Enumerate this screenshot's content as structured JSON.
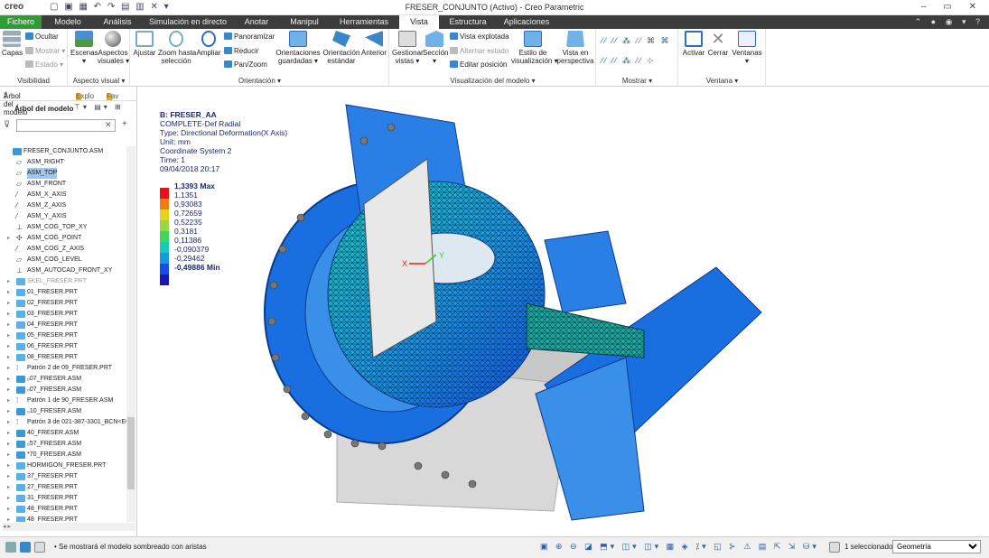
{
  "app": {
    "logo": "creo",
    "quick_access": "▢ ▣ ▦ ↶ ↷ ▤ ▥ ✕ ▾",
    "window_title": "FRESER_CONJUNTO (Activo) - Creo Parametric",
    "window_controls": "– ▭ ✕",
    "right_tools": "⌃ ● ◉ ▾ ?"
  },
  "tabs": [
    "Fichero",
    "Modelo",
    "Análisis",
    "Simulación en directo",
    "Anotar",
    "Manipul",
    "Herramientas",
    "Vista",
    "Estructura",
    "Aplicaciones"
  ],
  "ribbon": {
    "visibilidad": {
      "group": "Visibilidad",
      "capas": "Capas",
      "ocultar": "Ocultar",
      "mostrar": "Mostrar ▾",
      "estado": "Estado ▾"
    },
    "aspecto": {
      "group": "Aspecto visual ▾",
      "escenas": "Escenas\n▾",
      "aspectos": "Aspectos\nvisuales ▾"
    },
    "orientacion": {
      "group": "Orientación ▾",
      "ajustar": "Ajustar",
      "zoom_seleccion": "Zoom hasta\nselección",
      "ampliar": "Ampliar",
      "panoramizar": "Panoramizar",
      "reducir": "Reducir",
      "pan_zoom": "Pan/Zoom",
      "orientaciones": "Orientaciones\nguardadas ▾",
      "orientacion_estandar": "Orientación\nestándar",
      "anterior": "Anterior"
    },
    "visualizacion": {
      "group": "Visualización del modelo ▾",
      "gestionar": "Gestionar\nvistas ▾",
      "seccion": "Sección\n▾",
      "vista_explotada": "Vista explotada",
      "alternar_estado": "Alternar estado",
      "editar_posicion": "Editar posición",
      "estilo": "Estilo de\nvisualización ▾",
      "perspectiva": "Vista en\nperspectiva"
    },
    "mostrar": {
      "group": "Mostrar ▾"
    },
    "ventana": {
      "group": "Ventana ▾",
      "activar": "Activar",
      "cerrar": "Cerrar",
      "ventanas": "Ventanas\n▾"
    }
  },
  "panel": {
    "tab_tree": "Árbol del modelo",
    "tab_explorer": "Explo",
    "tab_fav": "Fav",
    "tree_header": "Árbol del modelo",
    "tree_tools": "⊤▾ ▤▾ ⊞",
    "search_placeholder": "",
    "scroll_arrows": "◂                                  ▸"
  },
  "tree": [
    {
      "t": "FRESER_CONJUNTO.ASM",
      "lvl": 0,
      "ic": "asm",
      "tw": ""
    },
    {
      "t": "ASM_RIGHT",
      "lvl": 1,
      "ic": "plane",
      "tw": ""
    },
    {
      "t": "ASM_TOP",
      "lvl": 1,
      "ic": "plane",
      "tw": "",
      "sel": true
    },
    {
      "t": "ASM_FRONT",
      "lvl": 1,
      "ic": "plane",
      "tw": ""
    },
    {
      "t": "ASM_X_AXIS",
      "lvl": 1,
      "ic": "axis",
      "tw": ""
    },
    {
      "t": "ASM_Z_AXIS",
      "lvl": 1,
      "ic": "axis",
      "tw": ""
    },
    {
      "t": "ASM_Y_AXIS",
      "lvl": 1,
      "ic": "axis",
      "tw": ""
    },
    {
      "t": "ASM_COG_TOP_XY",
      "lvl": 1,
      "ic": "csys",
      "tw": ""
    },
    {
      "t": "ASM_COG_POINT",
      "lvl": 1,
      "ic": "point",
      "tw": "▸"
    },
    {
      "t": "ASM_COG_Z_AXIS",
      "lvl": 1,
      "ic": "axis",
      "tw": ""
    },
    {
      "t": "ASM_COG_LEVEL",
      "lvl": 1,
      "ic": "plane",
      "tw": ""
    },
    {
      "t": "ASM_AUTOCAD_FRONT_XY",
      "lvl": 1,
      "ic": "csys",
      "tw": ""
    },
    {
      "t": "SKEL_FRESER.PRT",
      "lvl": 1,
      "ic": "part",
      "tw": "▸",
      "gray": true
    },
    {
      "t": "01_FRESER.PRT",
      "lvl": 1,
      "ic": "part",
      "tw": "▸"
    },
    {
      "t": "02_FRESER.PRT",
      "lvl": 1,
      "ic": "part",
      "tw": "▸"
    },
    {
      "t": "03_FRESER.PRT",
      "lvl": 1,
      "ic": "part",
      "tw": "▸"
    },
    {
      "t": "04_FRESER.PRT",
      "lvl": 1,
      "ic": "part",
      "tw": "▸"
    },
    {
      "t": "05_FRESER.PRT",
      "lvl": 1,
      "ic": "part",
      "tw": "▸"
    },
    {
      "t": "06_FRESER.PRT",
      "lvl": 1,
      "ic": "part",
      "tw": "▸"
    },
    {
      "t": "08_FRESER.PRT",
      "lvl": 1,
      "ic": "part",
      "tw": "▸"
    },
    {
      "t": "Patrón 2 de 09_FRESER.PRT",
      "lvl": 1,
      "ic": "pattern",
      "tw": "▸"
    },
    {
      "t": "₀07_FRESER.ASM",
      "lvl": 1,
      "ic": "asm",
      "tw": "▸"
    },
    {
      "t": "₀07_FRESER.ASM",
      "lvl": 1,
      "ic": "asm",
      "tw": "▸"
    },
    {
      "t": "Patrón 1 de 90_FRESER.ASM",
      "lvl": 1,
      "ic": "pattern",
      "tw": "▸"
    },
    {
      "t": "₀10_FRESER.ASM",
      "lvl": 1,
      "ic": "asm",
      "tw": "▸"
    },
    {
      "t": "Patrón 3 de 021-387-3301_BCN<EC",
      "lvl": 1,
      "ic": "pattern",
      "tw": "▸"
    },
    {
      "t": "40_FRESER.ASM",
      "lvl": 1,
      "ic": "asm",
      "tw": "▸"
    },
    {
      "t": "₀57_FRESER.ASM",
      "lvl": 1,
      "ic": "asm",
      "tw": "▸"
    },
    {
      "t": "*70_FRESER.ASM",
      "lvl": 1,
      "ic": "asm",
      "tw": "▸"
    },
    {
      "t": "HORMIGON_FRESER.PRT",
      "lvl": 1,
      "ic": "part",
      "tw": "▸"
    },
    {
      "t": "37_FRESER.PRT",
      "lvl": 1,
      "ic": "part",
      "tw": "▸"
    },
    {
      "t": "27_FRESER.PRT",
      "lvl": 1,
      "ic": "part",
      "tw": "▸"
    },
    {
      "t": "31_FRESER.PRT",
      "lvl": 1,
      "ic": "part",
      "tw": "▸"
    },
    {
      "t": "48_FRESER.PRT",
      "lvl": 1,
      "ic": "part",
      "tw": "▸"
    },
    {
      "t": "48_FRESER.PRT",
      "lvl": 1,
      "ic": "part",
      "tw": "▸"
    }
  ],
  "result": {
    "title": "B: FRESER_AA",
    "subtitle": "COMPLETE-Def Radial",
    "type": "Type: Directional Deformation(X Axis)",
    "unit": "Unit: mm",
    "csys": "Coordinate System 2",
    "time": "Time: 1",
    "date": "09/04/2018 20:17",
    "max_label": "1,3393 Max",
    "mid_labels": [
      "1,1351",
      "0,93083",
      "0,72659",
      "0,52235",
      "0,3181",
      "0,11386",
      "-0,090379",
      "-0,29462"
    ],
    "min_label": "-0,49886 Min",
    "colors": [
      "#e5101a",
      "#f07a14",
      "#e8d21a",
      "#9bd63b",
      "#3fd65e",
      "#18c9b9",
      "#1898e0",
      "#1050e6",
      "#1a16b5"
    ],
    "axis_y": "Y",
    "axis_x": "X"
  },
  "status": {
    "message": "• Se mostrará el modelo sombreado con aristas",
    "tools": "▣ ⊕ ⊖ ◪ ⬒▾ ◫▾ ◫▾ ▦ ◈ ⁒▾ ◱ ⊱ ⚠ ▤   ⇱ ⇲   ⛁▾",
    "selected_count": "1 seleccionado(",
    "filter": "Geometría"
  }
}
